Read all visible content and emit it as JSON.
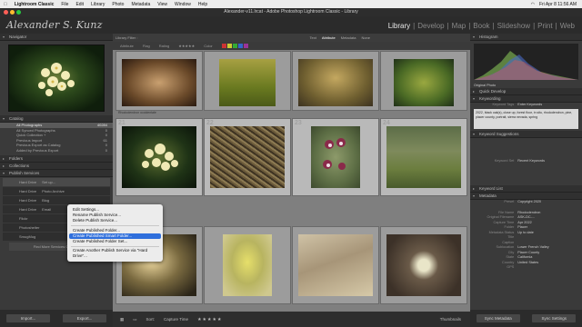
{
  "menubar": {
    "app": "Lightroom Classic",
    "items": [
      "File",
      "Edit",
      "Library",
      "Photo",
      "Metadata",
      "View",
      "Window",
      "Help"
    ],
    "clock": "Fri Apr 8 11:56 AM"
  },
  "window": {
    "title": "Alexander-v11.lrcat - Adobe Photoshop Lightroom Classic - Library"
  },
  "identity_plate": "Alexander S. Kunz",
  "modules": {
    "library": "Library",
    "develop": "Develop",
    "map": "Map",
    "book": "Book",
    "slideshow": "Slideshow",
    "print": "Print",
    "web": "Web",
    "sep": "|"
  },
  "left": {
    "navigator": "Navigator",
    "catalog": {
      "header": "Catalog",
      "rows": [
        {
          "label": "All Photographs",
          "count": "40284"
        },
        {
          "label": "All Synced Photographs",
          "count": "0"
        },
        {
          "label": "Quick Collection +",
          "count": "0"
        },
        {
          "label": "Previous Import",
          "count": "61"
        },
        {
          "label": "Previous Export as Catalog",
          "count": "0"
        },
        {
          "label": "Added by Previous Export",
          "count": "0"
        }
      ]
    },
    "folders": "Folders",
    "collections": "Collections",
    "publish": "Publish Services",
    "services": [
      {
        "name": "Hard Drive",
        "sub": "Set up..."
      },
      {
        "name": "Hard Drive",
        "sub": "Photo Archive"
      },
      {
        "name": "Hard Drive",
        "sub": "Blog"
      },
      {
        "name": "Hard Drive",
        "sub": "Email"
      },
      {
        "name": "Flickr",
        "sub": ""
      },
      {
        "name": "Photoshelter",
        "sub": ""
      },
      {
        "name": "SmugMug",
        "sub": ""
      }
    ],
    "find_more": "Find More Services Online...",
    "import_btn": "Import...",
    "export_btn": "Export..."
  },
  "center": {
    "library_filter": "Library Filter :",
    "filter_tabs": [
      "Text",
      "Attribute",
      "Metadata",
      "None"
    ],
    "attribute_label": "Attribute",
    "flag_label": "Flag",
    "rating_label": "Rating",
    "color_label": "Color",
    "cells": [
      {
        "num": "",
        "name": "Rhododendron occidentale",
        "sub": ""
      },
      {
        "num": "",
        "name": "",
        "sub": ""
      },
      {
        "num": "",
        "name": "",
        "sub": ""
      },
      {
        "num": "",
        "name": "",
        "sub": ""
      },
      {
        "num": "21",
        "name": "Rhododendron occidentale",
        "sub": "JPEG"
      },
      {
        "num": "22",
        "name": "Cones beneath pines",
        "sub": "JPEG"
      },
      {
        "num": "23",
        "name": "Erythronium",
        "sub": "JPEG"
      },
      {
        "num": "24",
        "name": "Forest floor",
        "sub": "JPEG"
      },
      {
        "num": "25",
        "name": "Foggy forest",
        "sub": "JPEG"
      },
      {
        "num": "26",
        "name": "Yellow flower",
        "sub": "JPEG"
      },
      {
        "num": "27",
        "name": "Lichen rock",
        "sub": "JPEG"
      },
      {
        "num": "28",
        "name": "Rock flowers",
        "sub": "JPEG"
      }
    ],
    "toolbar": {
      "sort_label": "Sort:",
      "sort_value": "Capture Time",
      "stars": "★★★★★",
      "thumbs": "Thumbnails"
    }
  },
  "context_menu": {
    "items": [
      "Edit Settings...",
      "Rename Publish Service...",
      "Delete Publish Service...",
      "Create Published Folder...",
      "Create Published Smart Folder...",
      "Create Published Folder Set...",
      "Create Another Publish Service via \"Hard Drive\"..."
    ],
    "highlighted_index": 4
  },
  "right": {
    "histogram": "Histogram",
    "original_photo": "Original Photo",
    "quick_develop": "Quick Develop",
    "keywording": "Keywording",
    "keyword_tags_label": "Keyword Tags",
    "keyword_tags_value": "Enter Keywords",
    "keyword_text": "2022, black oak(s), close up, forest floor, in situ, rhododendron, pine, placer county, portrait, sierra nevada, spring",
    "keyword_suggestions": "Keyword Suggestions",
    "keyword_set": "Keyword Set",
    "keyword_set_value": "Recent Keywords",
    "keyword_list": "Keyword List",
    "metadata": "Metadata",
    "preset_label": "Preset",
    "preset_value": "Copyright 2020",
    "fields": [
      {
        "k": "File Name",
        "v": "Rhododendron"
      },
      {
        "k": "Original Filename",
        "v": "ASK-DC-..."
      },
      {
        "k": "Capture Time",
        "v": "Apr 2022"
      },
      {
        "k": "Folder",
        "v": "Placer"
      },
      {
        "k": "Metadata Status",
        "v": "Up to date"
      },
      {
        "k": "Title",
        "v": ""
      },
      {
        "k": "Caption",
        "v": ""
      },
      {
        "k": "Sublocation",
        "v": "Lower French Valley"
      },
      {
        "k": "City",
        "v": "Placer County"
      },
      {
        "k": "State",
        "v": "California"
      },
      {
        "k": "Country",
        "v": "United States"
      },
      {
        "k": "GPS",
        "v": ""
      }
    ],
    "sync_metadata": "Sync Metadata",
    "sync_settings": "Sync Settings"
  },
  "colors": {
    "accent": "#2f6fdc",
    "selected": "#b9b9b9"
  }
}
